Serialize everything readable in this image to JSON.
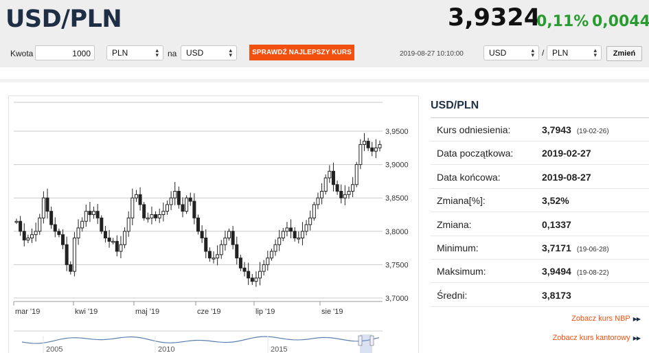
{
  "header": {
    "pair": "USD/PLN",
    "price": "3,9324",
    "change_percent": "0,11%",
    "change_abs": "0,0044"
  },
  "converter": {
    "amount_label": "Kwota",
    "amount_value": "1000",
    "from_currency": "PLN",
    "connector": "na",
    "to_currency": "USD",
    "cta_label": "SPRAWDŹ NAJLEPSZY KURS"
  },
  "pair_selector": {
    "timestamp": "2019-08-27 10:10:00",
    "base": "USD",
    "slash": "/",
    "quote": "PLN",
    "button_label": "Zmień"
  },
  "stats": {
    "title": "USD/PLN",
    "rows": [
      {
        "key": "Kurs odniesienia:",
        "value": "3,7943",
        "date": "(19-02-26)"
      },
      {
        "key": "Data początkowa:",
        "value": "2019-02-27",
        "date": ""
      },
      {
        "key": "Data końcowa:",
        "value": "2019-08-27",
        "date": ""
      },
      {
        "key": "Zmiana[%]:",
        "value": "3,52%",
        "date": ""
      },
      {
        "key": "Zmiana:",
        "value": "0,1337",
        "date": ""
      },
      {
        "key": "Minimum:",
        "value": "3,7171",
        "date": "(19-06-28)"
      },
      {
        "key": "Maksimum:",
        "value": "3,9494",
        "date": "(19-08-22)"
      },
      {
        "key": "Średni:",
        "value": "3,8173",
        "date": ""
      }
    ],
    "link_nbp": "Zobacz kurs NBP",
    "link_kantor": "Zobacz kurs kantorowy",
    "link_chevrons": "▶▶"
  },
  "colors": {
    "accent": "#f2500e",
    "positive": "#2a9b31",
    "title": "#1e2f45",
    "candle": "#222222",
    "navigator_line": "#5a7fb0"
  },
  "chart_data": {
    "type": "candlestick",
    "title": "",
    "xlabel": "",
    "ylabel": "",
    "x_ticks": [
      "mar '19",
      "kwi '19",
      "maj '19",
      "cze '19",
      "lip '19",
      "sie '19"
    ],
    "y_ticks": [
      "3,7000",
      "3,7500",
      "3,8000",
      "3,8500",
      "3,9000",
      "3,9500"
    ],
    "ylim": [
      3.7,
      3.95
    ],
    "grid": true,
    "close_series_approx": [
      3.815,
      3.8,
      3.787,
      3.79,
      3.795,
      3.8,
      3.82,
      3.85,
      3.83,
      3.81,
      3.8,
      3.795,
      3.78,
      3.75,
      3.74,
      3.79,
      3.805,
      3.815,
      3.83,
      3.825,
      3.83,
      3.82,
      3.8,
      3.79,
      3.785,
      3.785,
      3.77,
      3.78,
      3.8,
      3.82,
      3.85,
      3.855,
      3.84,
      3.82,
      3.82,
      3.825,
      3.82,
      3.825,
      3.83,
      3.84,
      3.85,
      3.86,
      3.84,
      3.83,
      3.85,
      3.845,
      3.82,
      3.8,
      3.79,
      3.77,
      3.76,
      3.76,
      3.765,
      3.78,
      3.79,
      3.8,
      3.78,
      3.76,
      3.745,
      3.74,
      3.73,
      3.725,
      3.73,
      3.74,
      3.75,
      3.76,
      3.77,
      3.78,
      3.79,
      3.8,
      3.805,
      3.8,
      3.79,
      3.79,
      3.8,
      3.81,
      3.82,
      3.84,
      3.85,
      3.86,
      3.88,
      3.89,
      3.87,
      3.86,
      3.85,
      3.855,
      3.86,
      3.87,
      3.9,
      3.93,
      3.935,
      3.925,
      3.92,
      3.925,
      3.93
    ],
    "navigator": {
      "x_ticks": [
        "2005",
        "2010",
        "2015"
      ]
    }
  }
}
